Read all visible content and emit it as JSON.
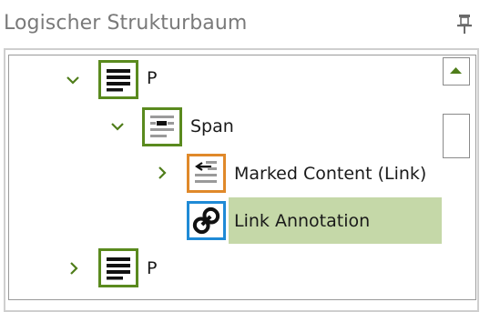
{
  "panel": {
    "title": "Logischer Strukturbaum",
    "pin_icon": "pin-icon"
  },
  "colors": {
    "paragraph_border": "#5a8a1e",
    "span_border": "#5a8a1e",
    "marked_content_border": "#e0892a",
    "link_annotation_border": "#1f8ad6",
    "chevron": "#4f7d1a",
    "selection": "#c5d8a8"
  },
  "tree": {
    "nodes": [
      {
        "label": "P",
        "icon": "paragraph-icon",
        "expanded": true
      },
      {
        "label": "Span",
        "icon": "span-icon",
        "expanded": true
      },
      {
        "label": "Marked Content (Link)",
        "icon": "marked-content-icon",
        "expanded": false
      },
      {
        "label": "Link Annotation",
        "icon": "link-icon",
        "selected": true
      },
      {
        "label": "P",
        "icon": "paragraph-icon",
        "expanded": false
      }
    ]
  },
  "scrollbar": {
    "up_icon": "scroll-up-icon"
  }
}
